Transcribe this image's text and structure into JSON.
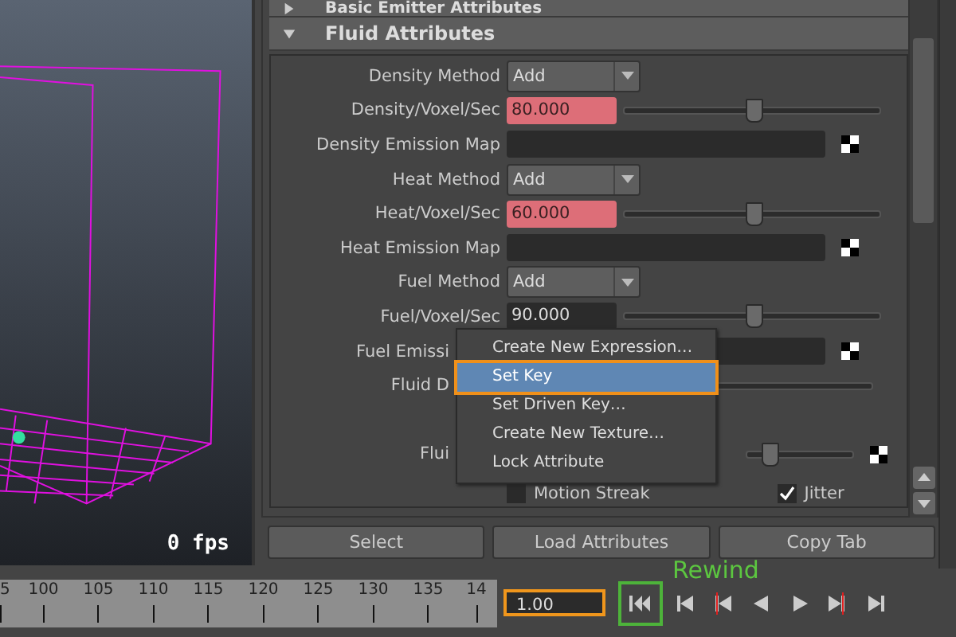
{
  "viewport": {
    "fps": "0 fps"
  },
  "sections": [
    {
      "title": "Basic Emitter Attributes",
      "expanded": false
    },
    {
      "title": "Fluid Attributes",
      "expanded": true
    }
  ],
  "rows": [
    {
      "kind": "dropdown",
      "label": "Density Method",
      "value": "Add"
    },
    {
      "kind": "slider",
      "label": "Density/Voxel/Sec",
      "value": "80.000",
      "keyed": true,
      "level": 0.5
    },
    {
      "kind": "map",
      "label": "Density Emission Map",
      "covered": false
    },
    {
      "kind": "dropdown",
      "label": "Heat Method",
      "value": "Add"
    },
    {
      "kind": "slider",
      "label": "Heat/Voxel/Sec",
      "value": "60.000",
      "keyed": true,
      "level": 0.5
    },
    {
      "kind": "map",
      "label": "Heat Emission Map",
      "covered": false
    },
    {
      "kind": "dropdown",
      "label": "Fuel Method",
      "value": "Add"
    },
    {
      "kind": "slider",
      "label": "Fuel/Voxel/Sec",
      "value": "90.000",
      "keyed": false,
      "level": 0.5
    },
    {
      "kind": "map",
      "label": "Fuel Emissi",
      "covered": true
    },
    {
      "kind": "track",
      "label": "Fluid D",
      "covered": true
    },
    {
      "kind": "blank"
    },
    {
      "kind": "mapslider",
      "label": "Flui",
      "covered": true,
      "level": 0.2
    },
    {
      "kind": "checks",
      "items": [
        {
          "label": "Motion Streak",
          "checked": false
        },
        {
          "label": "Jitter",
          "checked": true
        }
      ]
    }
  ],
  "menu": [
    {
      "label": "Create New Expression…",
      "selected": false
    },
    {
      "label": "Set Key",
      "selected": true
    },
    {
      "label": "Set Driven Key…",
      "selected": false
    },
    {
      "label": "Create New Texture…",
      "selected": false
    },
    {
      "label": "Lock Attribute",
      "selected": false
    }
  ],
  "buttons": [
    "Select",
    "Load Attributes",
    "Copy Tab"
  ],
  "timeline": {
    "ticks": [
      "5",
      "100",
      "105",
      "110",
      "115",
      "120",
      "125",
      "130",
      "135",
      "14"
    ],
    "frame": "1.00"
  },
  "tooltip": "Rewind",
  "playback": [
    {
      "kind": "rewind",
      "highlighted": true
    },
    {
      "kind": "step-back",
      "highlighted": false
    },
    {
      "kind": "key-back",
      "highlighted": false
    },
    {
      "kind": "play-back",
      "highlighted": false
    },
    {
      "kind": "play",
      "highlighted": false
    },
    {
      "kind": "key-forward",
      "highlighted": false
    },
    {
      "kind": "step-forward",
      "highlighted": false
    }
  ]
}
